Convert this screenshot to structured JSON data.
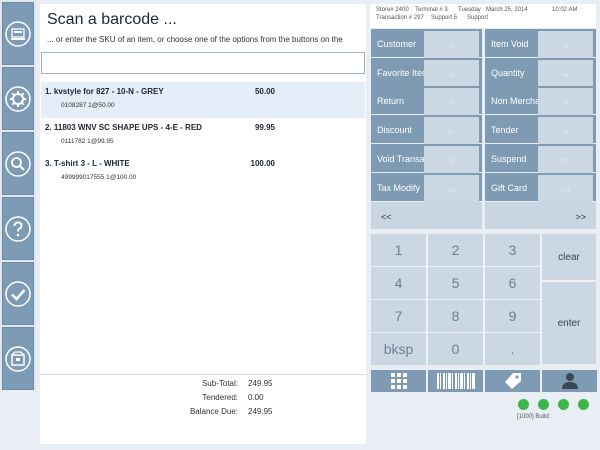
{
  "main": {
    "title": "Scan a barcode ...",
    "subtitle": "... or enter the SKU of an item, or choose one of the options from the buttons on the",
    "search_value": ""
  },
  "items": [
    {
      "title": "1. kvstyle for 827 - 10-N - GREY",
      "price": "50.00",
      "detail": "0108287  1@50.00",
      "selected": true
    },
    {
      "title": "2. 11803 WNV SC SHAPE UPS - 4-E - RED",
      "price": "99.95",
      "detail": "0111782  1@99.95",
      "selected": false
    },
    {
      "title": "3. T-shirt 3 - L - WHITE",
      "price": "100.00",
      "detail": "499999017555  1@100.00",
      "selected": false
    }
  ],
  "totals": {
    "subtotal_label": "Sub-Total:",
    "subtotal": "249.95",
    "tendered_label": "Tendered:",
    "tendered": "0.00",
    "balance_label": "Balance Due:",
    "balance": "249.95"
  },
  "header": {
    "store": "Store# 2400",
    "terminal": "Terminal # 3",
    "day": "Tuesday",
    "date": "March 25, 2014",
    "time": "10:02 AM",
    "transaction": "Transaction # 297",
    "support1": "Support 5",
    "support2": "Support"
  },
  "function_buttons": [
    {
      "label": "Customer",
      "key": "F1"
    },
    {
      "label": "Item Void",
      "key": "F2"
    },
    {
      "label": "Favorite Items",
      "key": "F3"
    },
    {
      "label": "Quantity",
      "key": "F4"
    },
    {
      "label": "Return",
      "key": "F5"
    },
    {
      "label": "Non Merchandise",
      "key": "F6"
    },
    {
      "label": "Discount",
      "key": "F7"
    },
    {
      "label": "Tender",
      "key": "F8"
    },
    {
      "label": "Void Transaction",
      "key": "F9"
    },
    {
      "label": "Suspend",
      "key": "F10"
    },
    {
      "label": "Tax Modify",
      "key": "F11"
    },
    {
      "label": "Gift Card",
      "key": "F12"
    }
  ],
  "nav": {
    "prev": "<<",
    "next": ">>"
  },
  "keypad": {
    "keys": [
      "1",
      "2",
      "3",
      "4",
      "5",
      "6",
      "7",
      "8",
      "9",
      "bksp",
      "0",
      "."
    ],
    "clear": "clear",
    "enter": "enter"
  },
  "sidebar_icons": [
    "register-icon",
    "gear-icon",
    "magnifier-icon",
    "help-icon",
    "checkmark-icon",
    "box-icon"
  ],
  "bottom_icons": [
    "keypad-grid-icon",
    "barcode-icon",
    "price-tag-icon",
    "user-icon"
  ],
  "status": {
    "build": "[1000]  Build:",
    "dot_color": "#3cb54a",
    "dot_count": 4
  },
  "colors": {
    "accent": "#7f9ab3",
    "panel": "#ffffff",
    "background": "#e9eef4",
    "key": "#cbd7e2",
    "selected_row": "#e4eef8"
  }
}
